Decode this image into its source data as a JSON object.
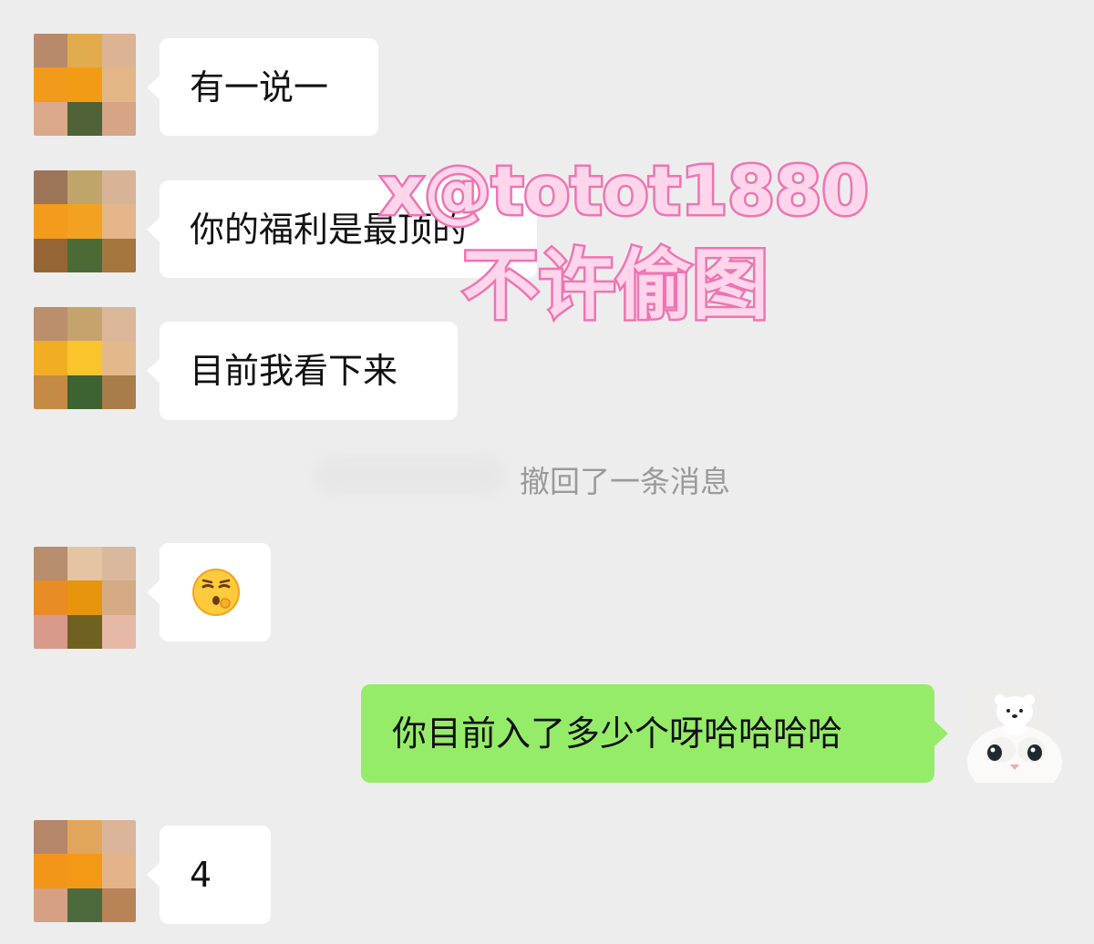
{
  "messages": [
    {
      "side": "left",
      "text": "有一说一"
    },
    {
      "side": "left",
      "text": "你的福利是最顶的"
    },
    {
      "side": "left",
      "text": "目前我看下来"
    },
    {
      "side": "system",
      "text": "撤回了一条消息"
    },
    {
      "side": "left",
      "emoji": "face-exhaling-emoji"
    },
    {
      "side": "right",
      "text": "你目前入了多少个呀哈哈哈哈"
    },
    {
      "side": "left",
      "text": "4"
    }
  ],
  "watermark": {
    "line1": "x@totot1880",
    "line2": "不许偷图"
  },
  "colors": {
    "background": "#ededed",
    "incoming_bubble": "#ffffff",
    "outgoing_bubble": "#95ec69",
    "recall_text": "#9a9a9a",
    "watermark_fill": "#ffd3ea",
    "watermark_stroke": "#f07cb8"
  }
}
